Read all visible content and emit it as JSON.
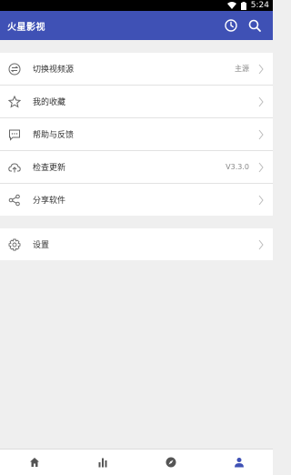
{
  "status": {
    "time": "5:24"
  },
  "appbar": {
    "title": "火星影视"
  },
  "menu": {
    "items": [
      {
        "label": "切换视频源",
        "value": "主源"
      },
      {
        "label": "我的收藏",
        "value": ""
      },
      {
        "label": "帮助与反馈",
        "value": ""
      },
      {
        "label": "检查更新",
        "value": "V3.3.0"
      },
      {
        "label": "分享软件",
        "value": ""
      }
    ],
    "settings": {
      "label": "设置"
    }
  },
  "colors": {
    "primary": "#3f51b5",
    "active_tab": "#3f51b5",
    "inactive_tab": "#555555"
  },
  "bottomnav": {
    "tabs": [
      "home-icon",
      "chart-icon",
      "compass-icon",
      "person-icon"
    ],
    "active": 3
  }
}
